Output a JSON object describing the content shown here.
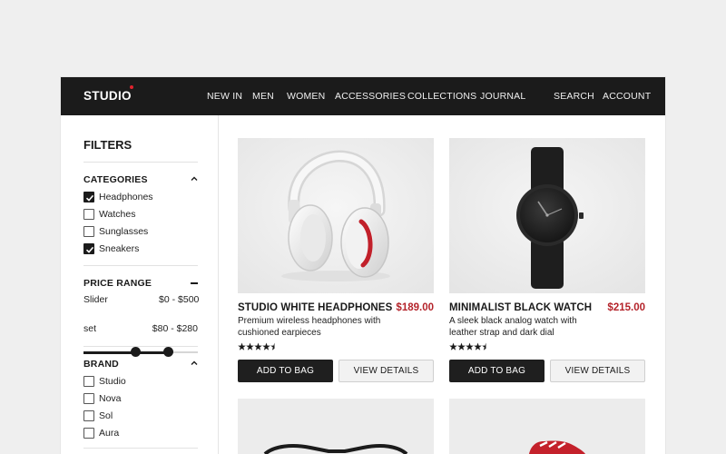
{
  "header": {
    "brand": "STUDIO",
    "nav": [
      "NEW IN",
      "MEN",
      "WOMEN",
      "ACCESSORIES",
      "COLLECTIONS",
      "JOURNAL"
    ],
    "search": "SEARCH",
    "account": "ACCOUNT"
  },
  "filters": {
    "title": "FILTERS",
    "categories": {
      "title": "CATEGORIES",
      "items": [
        {
          "label": "Headphones",
          "checked": true
        },
        {
          "label": "Watches",
          "checked": false
        },
        {
          "label": "Sunglasses",
          "checked": false
        },
        {
          "label": "Sneakers",
          "checked": true
        }
      ]
    },
    "price": {
      "title": "PRICE RANGE",
      "slider_label": "Slider",
      "range_full": "$0 - $500",
      "set_label": "set",
      "range_set": "$80 - $280",
      "min": 0,
      "max": 500,
      "low": 80,
      "high": 280
    },
    "brand": {
      "title": "BRAND",
      "items": [
        {
          "label": "Studio",
          "checked": false
        },
        {
          "label": "Nova",
          "checked": false
        },
        {
          "label": "Sol",
          "checked": false
        },
        {
          "label": "Aura",
          "checked": false
        }
      ]
    }
  },
  "products": [
    {
      "title": "STUDIO WHITE HEADPHONES",
      "price": "$189.00",
      "desc": "Premium wireless headphones with cushioned earpieces",
      "rating": 4.5,
      "add_label": "ADD TO BAG",
      "view_label": "VIEW DETAILS",
      "image_icon": "headphones-image"
    },
    {
      "title": "MINIMALIST BLACK WATCH",
      "price": "$215.00",
      "desc": "A sleek black analog watch with leather strap and dark dial",
      "rating": 4.5,
      "add_label": "ADD TO BAG",
      "view_label": "VIEW DETAILS",
      "image_icon": "watch-image"
    }
  ],
  "colors": {
    "accent": "#e0232e",
    "price": "#b4232a",
    "header_bg": "#1b1b1b"
  }
}
